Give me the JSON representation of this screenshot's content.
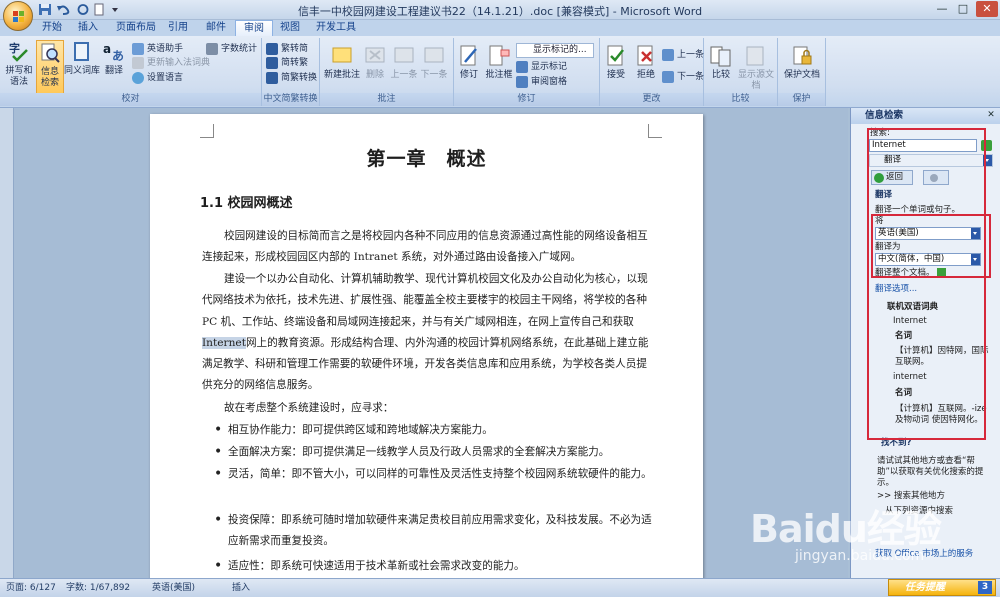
{
  "window": {
    "title": "信丰一中校园网建设工程建议书22（14.1.21）.doc [兼容模式] - Microsoft Word",
    "minimize": "—",
    "maximize": "□",
    "close": "✕"
  },
  "tabs": [
    "开始",
    "插入",
    "页面布局",
    "引用",
    "邮件",
    "审阅",
    "视图",
    "开发工具"
  ],
  "active_tab": "审阅",
  "ribbon": {
    "proofing": {
      "label": "校对",
      "spelling": "拼写和语法",
      "spelling_l1": "拼写和",
      "spelling_l2": "语法",
      "research": "信息检索",
      "research_l1": "信息",
      "research_l2": "检索",
      "thesaurus": "同义词库",
      "translate": "翻译",
      "english_assistant": "英语助手",
      "update_ime": "更新输入法词典",
      "set_language": "设置语言",
      "word_count": "字数统计"
    },
    "chinese": {
      "label": "中文简繁转换",
      "to_simplified": "繁转简",
      "to_traditional": "简转繁",
      "convert": "简繁转换"
    },
    "comments": {
      "label": "批注",
      "new": "新建批注",
      "delete": "删除",
      "previous": "上一条",
      "next": "下一条"
    },
    "tracking": {
      "label": "修订",
      "track_changes": "修订",
      "balloons": "批注框",
      "show_markup_value": "显示标记的...",
      "show_markup": "显示标记",
      "reviewing_pane": "审阅窗格"
    },
    "changes": {
      "label": "更改",
      "accept": "接受",
      "reject": "拒绝",
      "previous": "上一条",
      "next": "下一条"
    },
    "compare": {
      "label": "比较",
      "compare": "比较",
      "show_source": "显示源文档"
    },
    "protect": {
      "label": "保护",
      "protect_doc": "保护文档"
    }
  },
  "document": {
    "chapter_title": "第一章　概述",
    "section_title": "1.1  校园网概述",
    "paragraphs": [
      "校园网建设的目标简而言之是将校园内各种不同应用的信息资源通过高性能的网络设备相互连接起来，形成校园园区内部的 Intranet 系统，对外通过路由设备接入广域网。",
      "建设一个以办公自动化、计算机辅助教学、现代计算机校园文化及办公自动化为核心，以现代网络技术为依托，技术先进、扩展性强、能覆盖全校主要楼宇的校园主干网络，将学校的各种 PC 机、工作站、终端设备和局域网连接起来，并与有关广域网相连，在网上宣传自己和获取",
      "Internet",
      "网上的教育资源。形成结构合理、内外沟通的校园计算机网络系统，在此基础上建立能满足教学、科研和管理工作需要的软硬件环境，开发各类信息库和应用系统，为学校各类人员提供充分的网络信息服务。",
      "故在考虑整个系统建设时，应寻求："
    ],
    "bullets": [
      "相互协作能力：即可提供跨区域和跨地域解决方案能力。",
      "全面解决方案：即可提供满足一线教学人员及行政人员需求的全套解决方案能力。",
      "灵活，简单：即不管大小，可以同样的可靠性及灵活性支持整个校园网系统软硬件的能力。",
      "投资保障：即系统可随时增加软硬件来满足贵校目前应用需求变化，及科技发展。不必为适应新需求而重复投资。",
      "适应性：即系统可快速适用于技术革新或社会需求改变的能力。"
    ]
  },
  "pane": {
    "title": "信息检索",
    "search_label": "搜索:",
    "search_value": "Internet",
    "service_value": "翻译",
    "back_label": "返回",
    "section_translate": "翻译",
    "translate_hint": "翻译一个单词或句子。",
    "from_label": "将",
    "from_value": "英语(美国)",
    "to_label": "翻译为",
    "to_value": "中文(简体，中国)",
    "translate_doc": "翻译整个文档。",
    "options_link": "翻译选项...",
    "dict_label": "联机双语词典",
    "entry1": "Internet",
    "pos1": "名词",
    "def1": "【计算机】因特网，国际互联网。",
    "entry2": "internet",
    "pos2": "名词",
    "def2": "【计算机】互联网。-ize 及物动词 使因特网化。",
    "not_found": "找不到?",
    "try_text": "请试试其他地方或查看“帮助”以获取有关优化搜索的提示。",
    "search_elsewhere": ">> 搜索其他地方",
    "from_following": "从下列资源中搜索",
    "office_market": "获取 Office 市场上的服务"
  },
  "statusbar": {
    "page": "页面: 6/127",
    "words": "字数: 1/67,892",
    "language": "英语(美国)",
    "mode": "插入"
  },
  "watermark": {
    "brand": "Baidu经验",
    "url": "jingyan.baidu.com"
  },
  "taskbar": {
    "label": "任务提醒",
    "count": "3"
  }
}
